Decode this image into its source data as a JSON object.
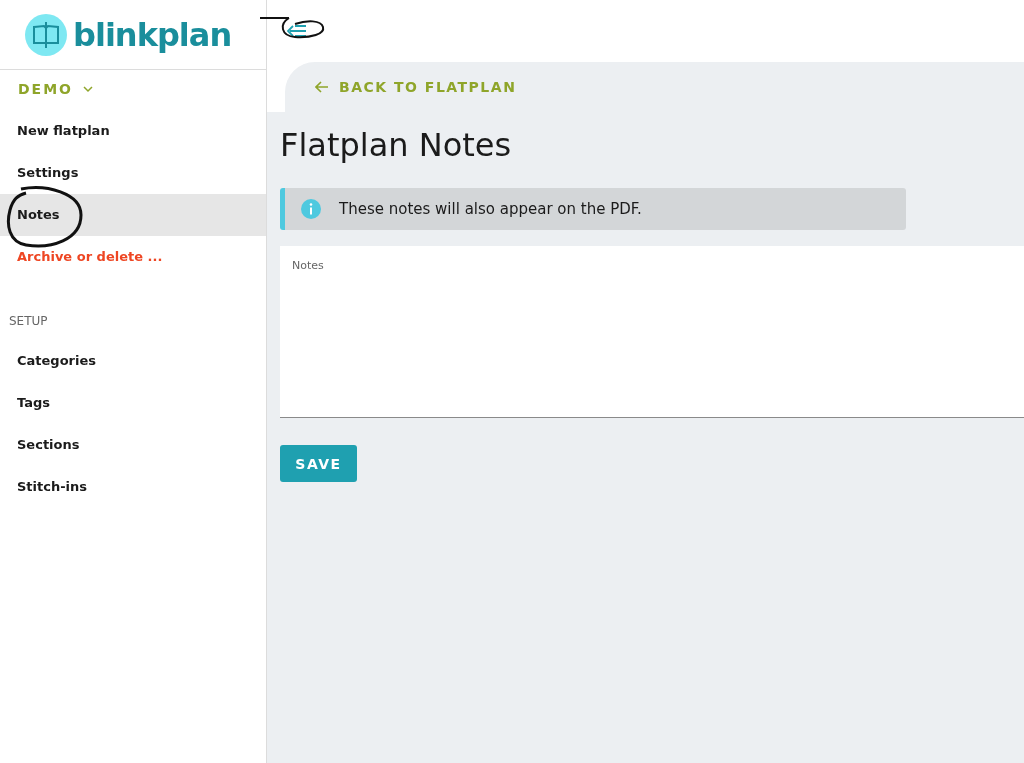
{
  "logo": {
    "text": "blinkplan"
  },
  "project": {
    "label": "DEMO"
  },
  "sidebar": {
    "items": [
      {
        "label": "New flatplan",
        "kind": "normal",
        "selected": false
      },
      {
        "label": "Settings",
        "kind": "normal",
        "selected": false
      },
      {
        "label": "Notes",
        "kind": "normal",
        "selected": true
      },
      {
        "label": "Archive or delete ...",
        "kind": "danger",
        "selected": false
      }
    ],
    "setup": {
      "heading": "SETUP",
      "items": [
        {
          "label": "Categories",
          "selected": false
        },
        {
          "label": "Tags",
          "selected": false
        },
        {
          "label": "Sections",
          "selected": false
        },
        {
          "label": "Stitch-ins",
          "selected": false
        }
      ]
    }
  },
  "back_link": "BACK TO FLATPLAN",
  "title": "Flatplan Notes",
  "alert": {
    "text": "These notes will also appear on the PDF."
  },
  "notes_field": {
    "label": "Notes"
  },
  "save_button": "SAVE"
}
